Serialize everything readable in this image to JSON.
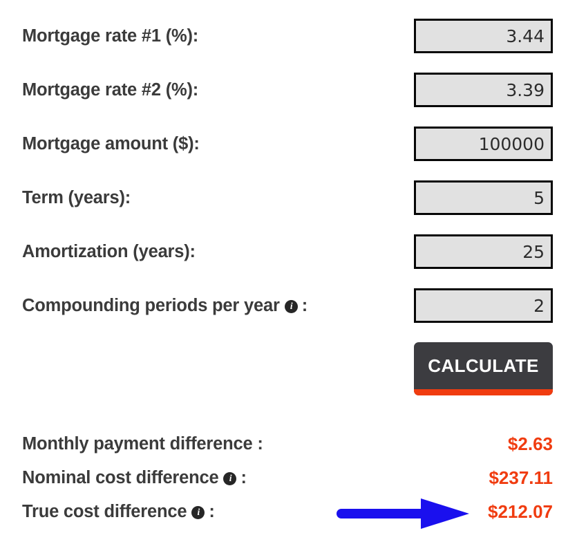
{
  "form": {
    "fields": [
      {
        "label": "Mortgage rate #1 (%):",
        "value": "3.44",
        "has_info_icon": false,
        "name": "mortgage-rate-1"
      },
      {
        "label": "Mortgage rate #2 (%):",
        "value": "3.39",
        "has_info_icon": false,
        "name": "mortgage-rate-2"
      },
      {
        "label": "Mortgage amount ($):",
        "value": "100000",
        "has_info_icon": false,
        "name": "mortgage-amount"
      },
      {
        "label": "Term (years):",
        "value": "5",
        "has_info_icon": false,
        "name": "term-years"
      },
      {
        "label": "Amortization (years):",
        "value": "25",
        "has_info_icon": false,
        "name": "amortization-years"
      },
      {
        "label": "Compounding periods per year",
        "value": "2",
        "has_info_icon": true,
        "colon": ":",
        "name": "compounding-periods"
      }
    ]
  },
  "actions": {
    "calculate_label": "CALCULATE"
  },
  "results": {
    "rows": [
      {
        "label": "Monthly payment difference :",
        "value": "$2.63",
        "has_info_icon": false,
        "name": "monthly-payment-difference"
      },
      {
        "label": "Nominal cost difference",
        "colon": ":",
        "value": "$237.11",
        "has_info_icon": true,
        "name": "nominal-cost-difference"
      },
      {
        "label": "True cost difference",
        "colon": ":",
        "value": "$212.07",
        "has_info_icon": true,
        "name": "true-cost-difference"
      }
    ]
  },
  "annotation": {
    "arrow_color": "#1a10ee",
    "points_to": "$212.07"
  },
  "icons": {
    "info": "i"
  },
  "colors": {
    "label_text": "#3b3b3b",
    "result_accent": "#f03c10",
    "button_bg": "#3c3c40",
    "button_underline": "#f03c10",
    "input_bg": "#e1e1e1",
    "input_border": "#060606",
    "arrow": "#1a10ee"
  }
}
